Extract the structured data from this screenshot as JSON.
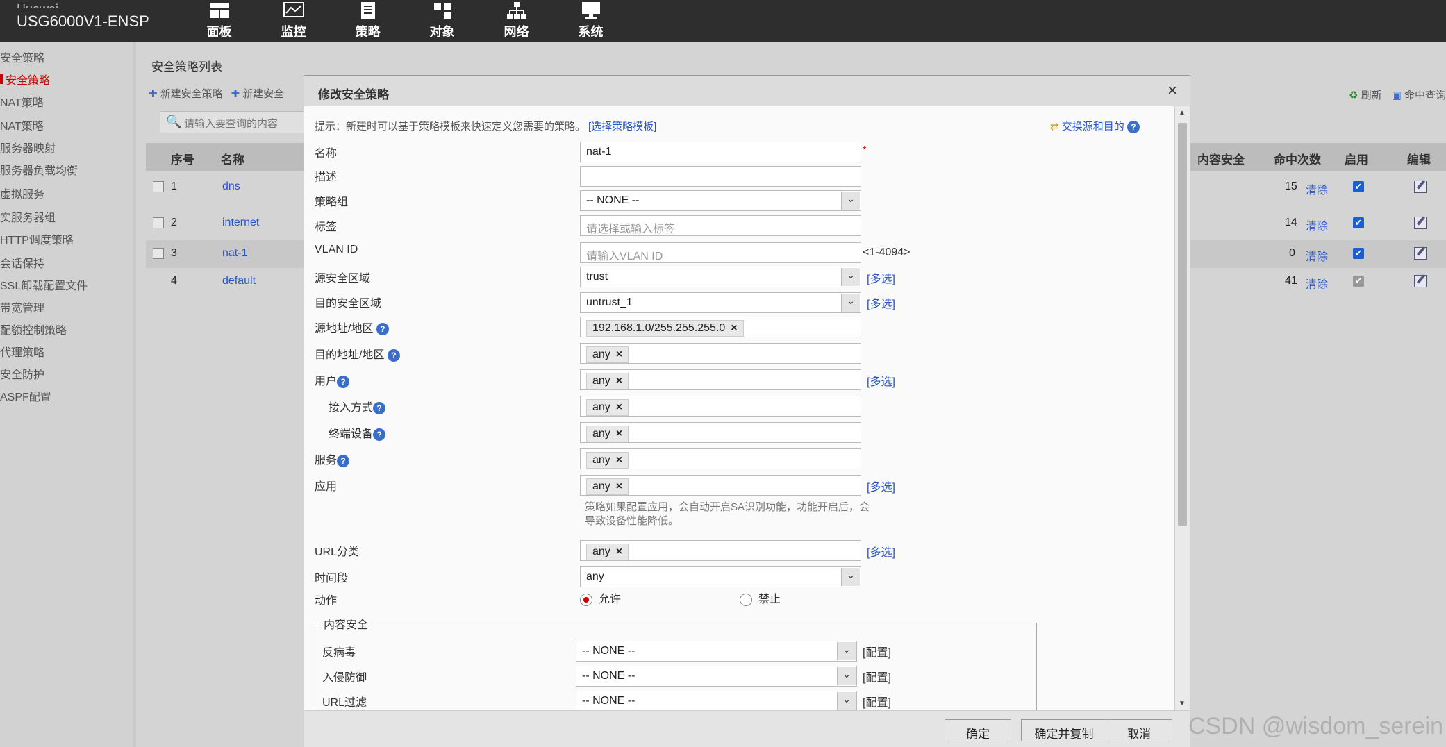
{
  "topbar": {
    "vendor": "Huawei",
    "model": "USG6000V1-ENSP",
    "nav": [
      {
        "label": "面板",
        "icon": "dashboard-icon"
      },
      {
        "label": "监控",
        "icon": "monitor-icon"
      },
      {
        "label": "策略",
        "icon": "policy-icon"
      },
      {
        "label": "对象",
        "icon": "object-icon"
      },
      {
        "label": "网络",
        "icon": "network-icon"
      },
      {
        "label": "系统",
        "icon": "system-icon"
      }
    ]
  },
  "sidebar": {
    "items": [
      {
        "label": "安全策略",
        "active": false
      },
      {
        "label": "安全策略",
        "active": true
      },
      {
        "label": "NAT策略",
        "active": false
      },
      {
        "label": "NAT策略",
        "active": false
      },
      {
        "label": "服务器映射",
        "active": false
      },
      {
        "label": "服务器负载均衡",
        "active": false
      },
      {
        "label": "虚拟服务",
        "active": false
      },
      {
        "label": "实服务器组",
        "active": false
      },
      {
        "label": "HTTP调度策略",
        "active": false
      },
      {
        "label": "会话保持",
        "active": false
      },
      {
        "label": "SSL卸载配置文件",
        "active": false
      },
      {
        "label": "带宽管理",
        "active": false
      },
      {
        "label": "配额控制策略",
        "active": false
      },
      {
        "label": "代理策略",
        "active": false
      },
      {
        "label": "安全防护",
        "active": false
      },
      {
        "label": "ASPF配置",
        "active": false
      }
    ]
  },
  "main": {
    "title": "安全策略列表",
    "toolbar": [
      "新建安全策略",
      "新建安全"
    ],
    "search_placeholder": "请输入要查询的内容",
    "right_tools": [
      "刷新",
      "命中查询"
    ],
    "columns": [
      "序号",
      "名称",
      "内容安全",
      "命中次数",
      "启用",
      "编辑"
    ],
    "rows": [
      {
        "no": "1",
        "name": "dns",
        "hits": "15",
        "clear": "清除",
        "enabled": true
      },
      {
        "no": "2",
        "name": "internet",
        "hits": "14",
        "clear": "清除",
        "enabled": true
      },
      {
        "no": "3",
        "name": "nat-1",
        "hits": "0",
        "clear": "清除",
        "enabled": true
      },
      {
        "no": "4",
        "name": "default",
        "hits": "41",
        "clear": "清除",
        "enabled": false
      }
    ]
  },
  "modal": {
    "title": "修改安全策略",
    "close": "×",
    "tip": "提示：新建时可以基于策略模板来快速定义您需要的策略。",
    "tip_link": "[选择策略模板]",
    "swap": "交换源和目的",
    "help": "?",
    "fields": {
      "name_label": "名称",
      "name_value": "nat-1",
      "required": "*",
      "desc_label": "描述",
      "desc_value": "",
      "group_label": "策略组",
      "group_value": "-- NONE --",
      "tag_label": "标签",
      "tag_placeholder": "请选择或输入标签",
      "vlan_label": "VLAN ID",
      "vlan_placeholder": "请输入VLAN ID",
      "vlan_range": "<1-4094>",
      "src_zone_label": "源安全区域",
      "src_zone_value": "trust",
      "dst_zone_label": "目的安全区域",
      "dst_zone_value": "untrust_1",
      "src_addr_label": "源地址/地区",
      "src_addr_value": "192.168.1.0/255.255.255.0",
      "dst_addr_label": "目的地址/地区",
      "dst_addr_value": "any",
      "user_label": "用户",
      "user_value": "any",
      "access_label": "接入方式",
      "access_value": "any",
      "terminal_label": "终端设备",
      "terminal_value": "any",
      "service_label": "服务",
      "service_value": "any",
      "app_label": "应用",
      "app_value": "any",
      "app_note": "策略如果配置应用，会自动开启SA识别功能，功能开启后，会导致设备性能降低。",
      "url_label": "URL分类",
      "url_value": "any",
      "time_label": "时间段",
      "time_value": "any",
      "action_label": "动作",
      "action_permit": "允许",
      "action_deny": "禁止"
    },
    "multi_select": "[多选]",
    "tag_remove": "×",
    "content_security": {
      "legend": "内容安全",
      "antivirus_label": "反病毒",
      "antivirus_value": "-- NONE --",
      "ips_label": "入侵防御",
      "ips_value": "-- NONE --",
      "urlfilter_label": "URL过滤",
      "urlfilter_value": "-- NONE --",
      "config": "[配置]"
    },
    "buttons": {
      "ok": "确定",
      "ok_copy": "确定并复制",
      "cancel": "取消"
    }
  },
  "watermark": "CSDN @wisdom_serein"
}
